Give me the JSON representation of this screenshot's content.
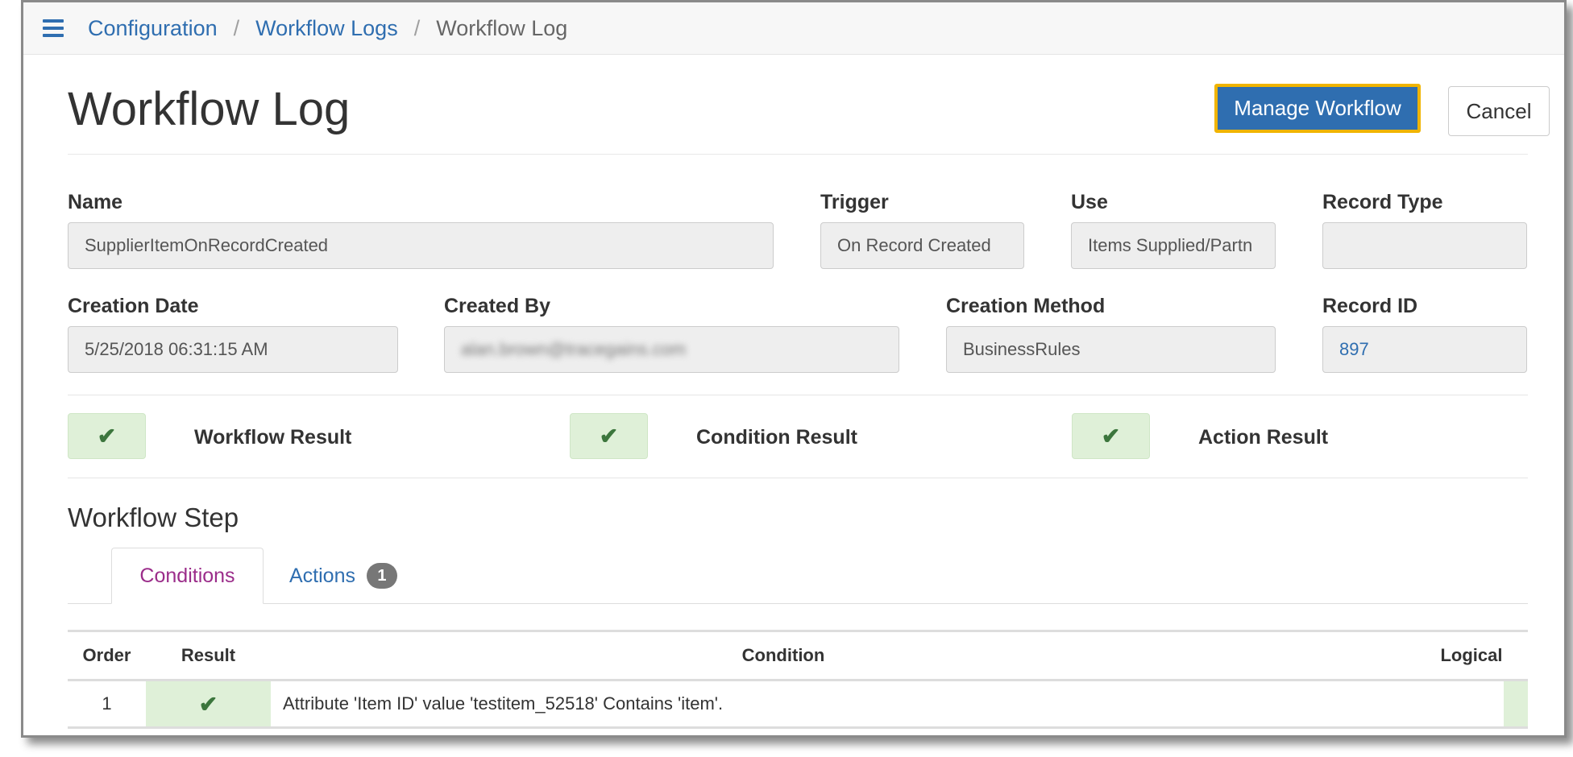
{
  "breadcrumb": {
    "items": [
      {
        "label": "Configuration"
      },
      {
        "label": "Workflow Logs"
      }
    ],
    "separator": "/",
    "current": "Workflow Log"
  },
  "page": {
    "title": "Workflow Log",
    "manage_button": "Manage Workflow",
    "cancel_button": "Cancel"
  },
  "fields": {
    "name": {
      "label": "Name",
      "value": "SupplierItemOnRecordCreated"
    },
    "trigger": {
      "label": "Trigger",
      "value": "On Record Created"
    },
    "use": {
      "label": "Use",
      "value": "Items Supplied/Partn"
    },
    "record_type": {
      "label": "Record Type",
      "value": ""
    },
    "creation_date": {
      "label": "Creation Date",
      "value": "5/25/2018 06:31:15 AM"
    },
    "created_by": {
      "label": "Created By",
      "value": "alan.brown@tracegains.com"
    },
    "creation_method": {
      "label": "Creation Method",
      "value": "BusinessRules"
    },
    "record_id": {
      "label": "Record ID",
      "value": "897"
    }
  },
  "results": {
    "workflow": {
      "label": "Workflow Result",
      "icon": "check-icon"
    },
    "condition": {
      "label": "Condition Result",
      "icon": "check-icon"
    },
    "action": {
      "label": "Action Result",
      "icon": "check-icon"
    }
  },
  "workflow_step": {
    "title": "Workflow Step",
    "tabs": [
      {
        "label": "Conditions",
        "active": true
      },
      {
        "label": "Actions",
        "badge": "1",
        "active": false
      }
    ]
  },
  "conditions_table": {
    "columns": [
      "Order",
      "Result",
      "Condition",
      "Logical"
    ],
    "rows": [
      {
        "order": "1",
        "result_icon": "check-icon",
        "condition": "Attribute 'Item ID' value 'testitem_52518' Contains 'item'.",
        "logical": ""
      }
    ]
  },
  "colors": {
    "accent": "#2f6eb0",
    "highlight_border": "#f0b400",
    "success_bg": "#dff0d8",
    "success_fg": "#3c763d",
    "active_tab": "#9b2d8a"
  }
}
